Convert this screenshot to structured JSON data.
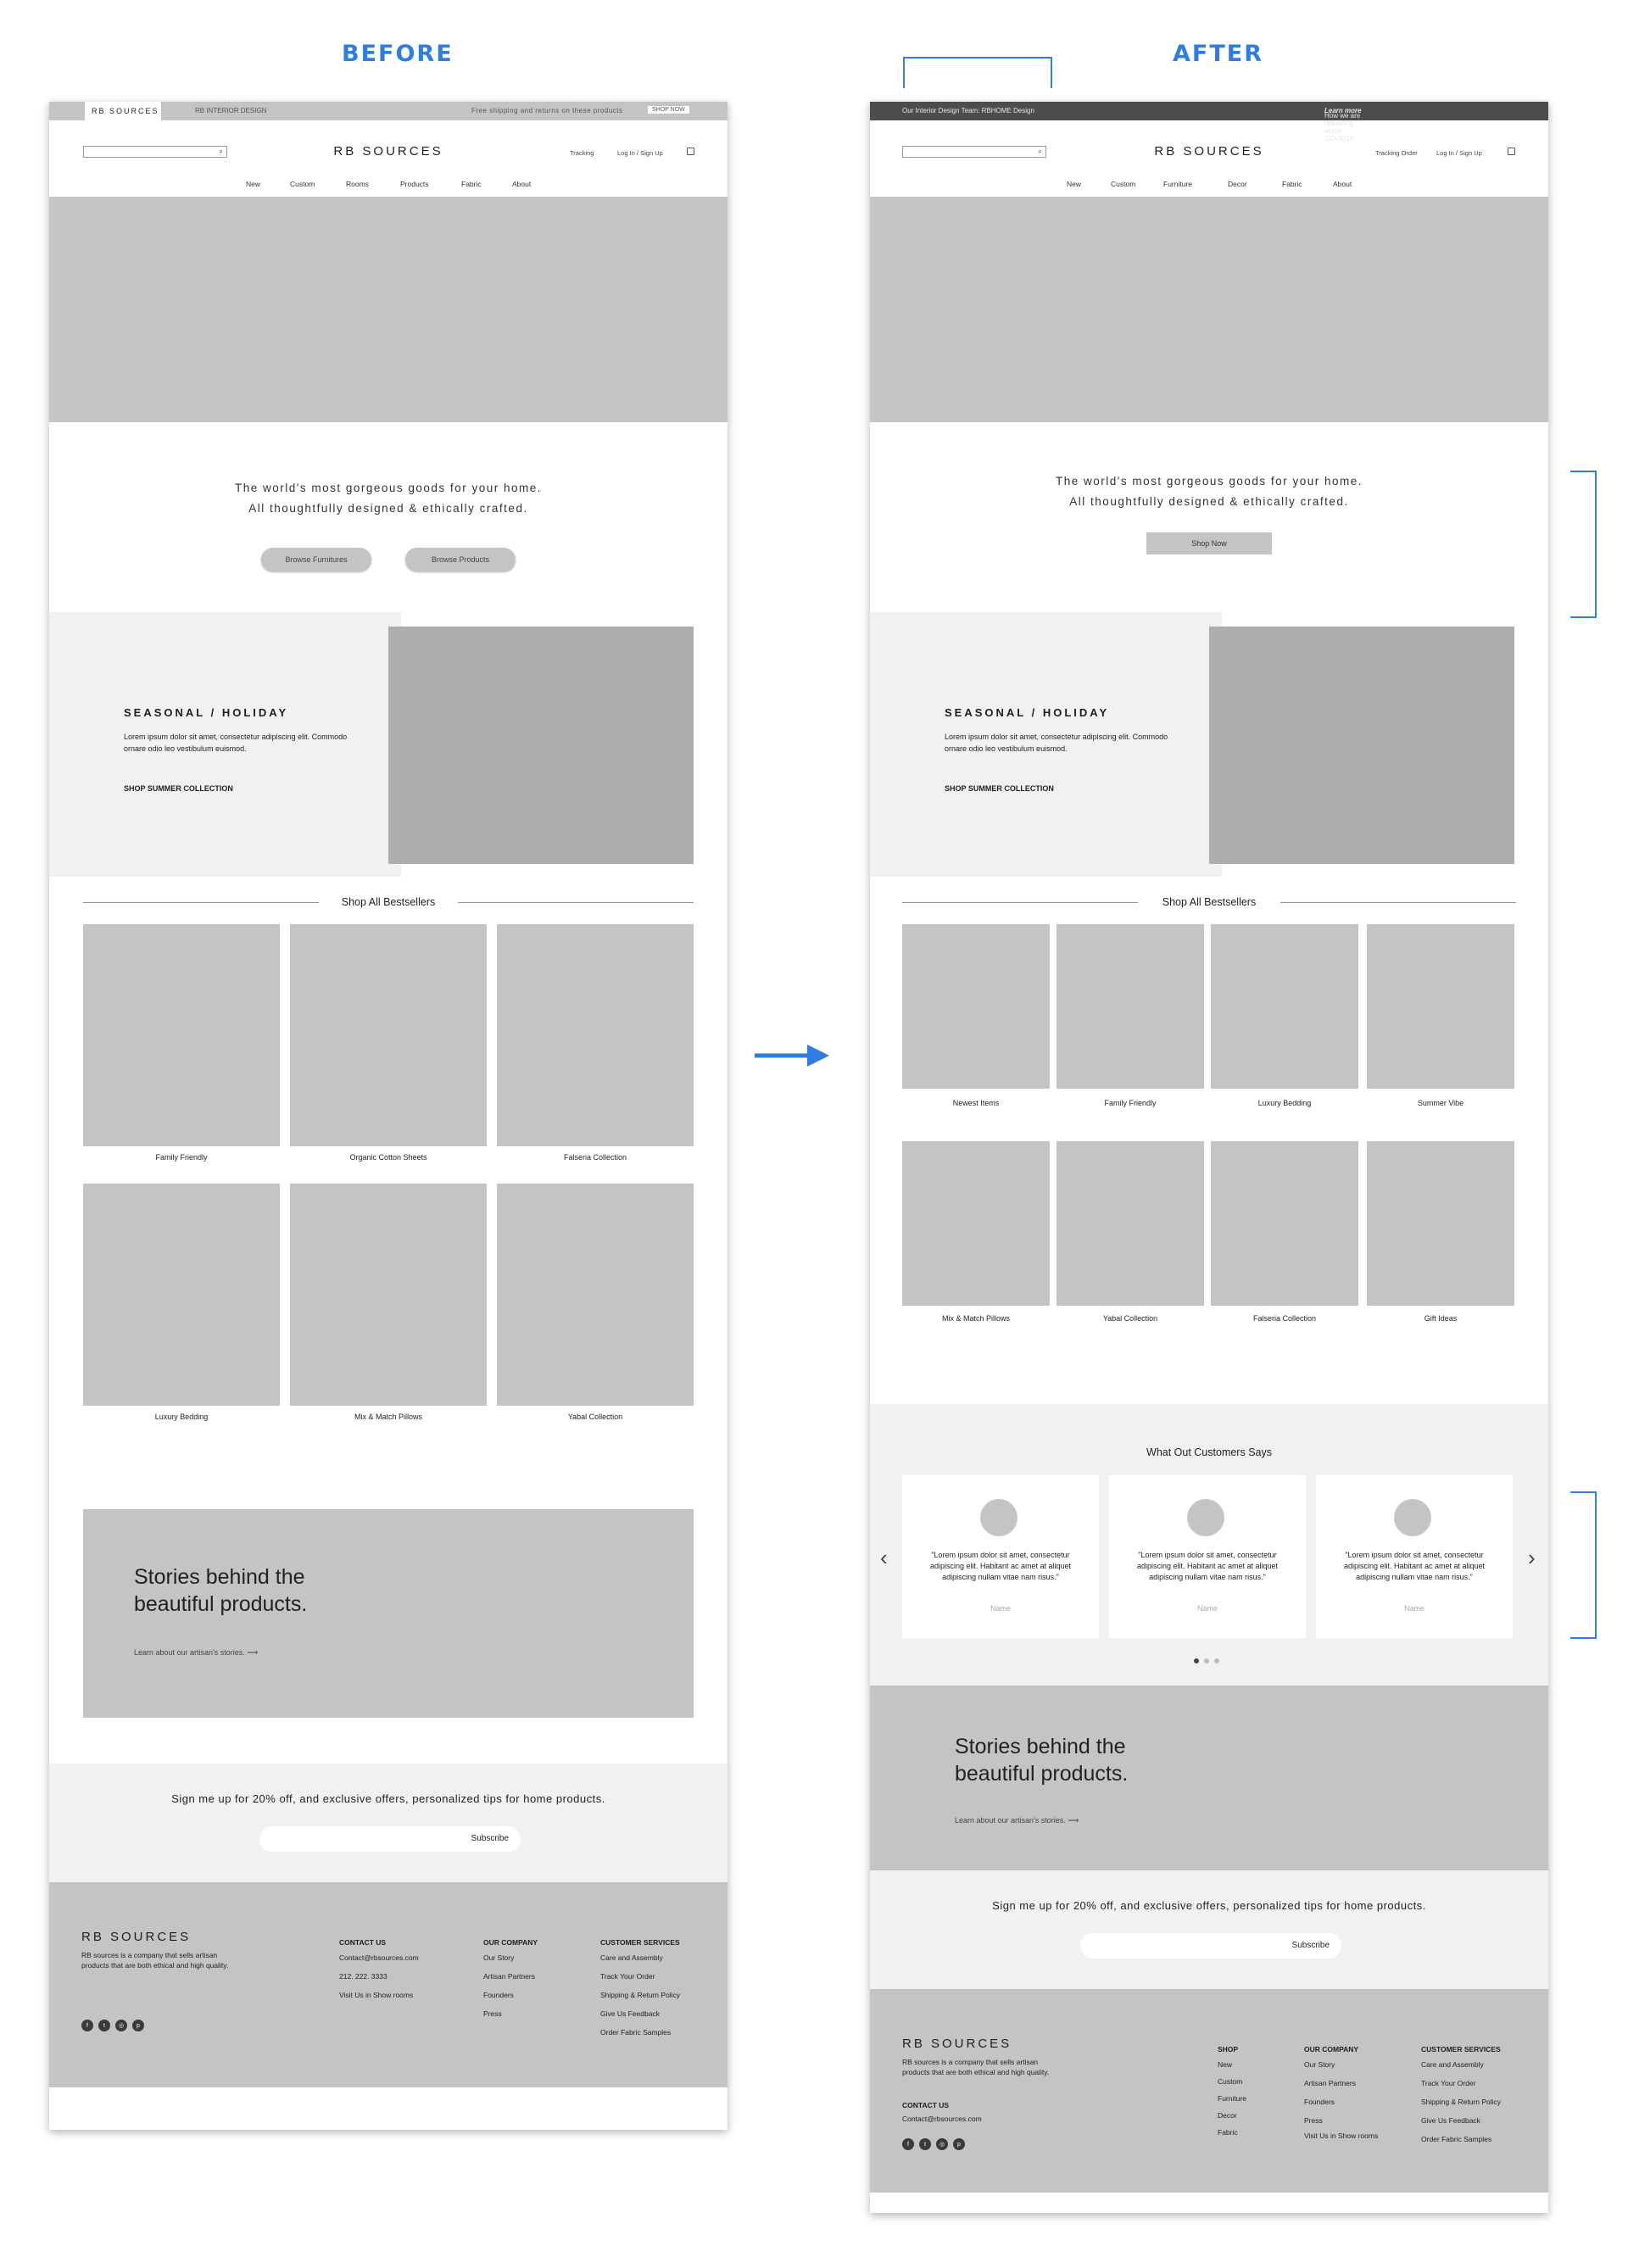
{
  "labels": {
    "before": "BEFORE",
    "after": "AFTER"
  },
  "brand": "RB SOURCES",
  "before": {
    "topbar": {
      "logo": "RB SOURCES",
      "interior": "RB INTERIOR DESIGN",
      "shipping": "Free shipping and returns on these products",
      "shop_now": "SHOP NOW"
    },
    "header": {
      "tracking": "Tracking",
      "login": "Log In / Sign Up"
    },
    "nav": [
      "New",
      "Custom",
      "Rooms",
      "Products",
      "Fabric",
      "About"
    ],
    "tagline": {
      "line1": "The world's most gorgeous goods for your home.",
      "line2": "All thoughtfully designed & ethically crafted."
    },
    "buttons": {
      "browse_furnitures": "Browse Furnitures",
      "browse_products": "Browse Products"
    },
    "bestsellers": [
      "Family Friendly",
      "Organic Cotton Sheets",
      "Falseria Collection",
      "Luxury Bedding",
      "Mix & Match Pillows",
      "Yabal Collection"
    ],
    "footer": {
      "contact_head": "CONTACT US",
      "contact": [
        "Contact@rbsources.com",
        "212. 222. 3333",
        "Visit Us in Show rooms"
      ],
      "company_head": "OUR COMPANY",
      "company": [
        "Our Story",
        "Artisan Partners",
        "Founders",
        "Press"
      ],
      "service_head": "CUSTOMER SERVICES",
      "service": [
        "Care and Assembly",
        "Track Your Order",
        "Shipping & Return Policy",
        "Give Us Feedback",
        "Order Fabric Samples"
      ]
    }
  },
  "after": {
    "topbar": {
      "team": "Our Interior Design Team:  RBHOME Design",
      "covid": "How we are operating within COVID19.",
      "learn_more": "Learn more"
    },
    "header": {
      "tracking": "Tracking Order",
      "login": "Log In / Sign Up"
    },
    "nav": [
      "New",
      "Custom",
      "Furniture",
      "Decor",
      "Fabric",
      "About"
    ],
    "shop_now": "Shop Now",
    "bestsellers": [
      "Newest Items",
      "Family Friendly",
      "Luxury Bedding",
      "Summer Vibe",
      "Mix & Match Pillows",
      "Yabal Collection",
      "Falseria Collection",
      "Gift Ideas"
    ],
    "testimonials": {
      "title": "What Out Customers Says",
      "quote": "\"Lorem ipsum dolor sit amet, consectetur adipiscing elit. Habitant ac amet at aliquet adipiscing nullam vitae nam risus.\"",
      "name": "Name"
    },
    "footer": {
      "contact_head": "CONTACT US",
      "email": "Contact@rbsources.com",
      "shop_head": "SHOP",
      "shop": [
        "New",
        "Custom",
        "Furniture",
        "Decor",
        "Fabric"
      ],
      "company_head": "OUR COMPANY",
      "company": [
        "Our Story",
        "Artisan Partners",
        "Founders",
        "Press",
        "Visit Us in Show rooms"
      ],
      "service_head": "CUSTOMER SERVICES",
      "service": [
        "Care and Assembly",
        "Track Your Order",
        "Shipping & Return Policy",
        "Give Us Feedback",
        "Order Fabric Samples"
      ]
    }
  },
  "seasonal": {
    "title": "SEASONAL / HOLIDAY",
    "body": "Lorem ipsum dolor sit amet, consectetur adipiscing elit. Commodo ornare odio leo vestibulum euismod.",
    "cta": "SHOP SUMMER COLLECTION"
  },
  "bestsellers_title": "Shop All Bestsellers",
  "stories": {
    "line1": "Stories behind the",
    "line2": "beautiful products.",
    "link": "Learn about our artisan's stories."
  },
  "signup": {
    "text": "Sign me up for 20% off, and exclusive offers, personalized tips for home products.",
    "button": "Subscribe"
  },
  "footer_desc": "RB sources is a company that sells artisan products that are both ethical and high quality.",
  "social_icons": [
    "facebook-icon",
    "twitter-icon",
    "instagram-icon",
    "pinterest-icon"
  ],
  "colors": {
    "accent": "#2f7de1",
    "placeholder": "#c4c4c4",
    "panel": "#f1f1f1",
    "image": "#adadad",
    "dark_bar": "#4d4d4d"
  }
}
